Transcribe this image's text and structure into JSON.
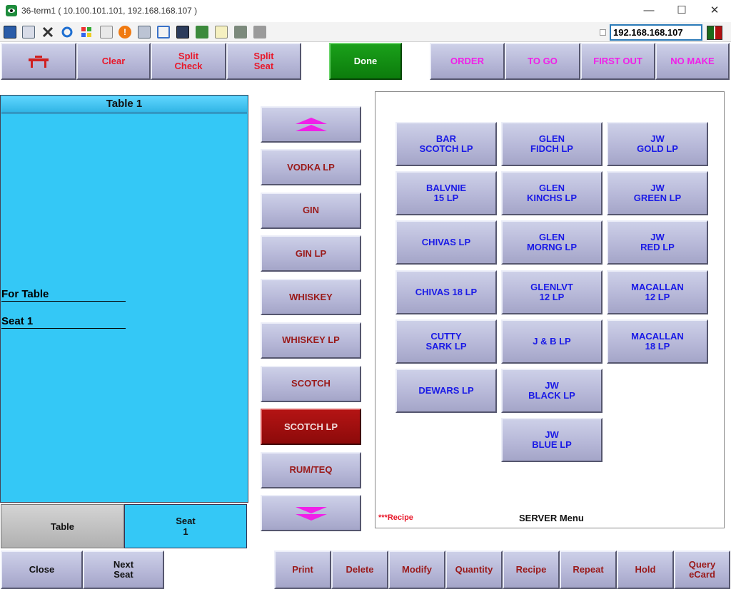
{
  "window": {
    "title": "36-term1 ( 10.100.101.101, 192.168.168.107 )",
    "minimize": "—",
    "maximize": "☐",
    "close": "✕"
  },
  "toolbar": {
    "icons": [
      "monitor-icon",
      "windows-icon",
      "tools-icon",
      "refresh-icon",
      "windows-logo-icon",
      "keyboard-icon",
      "alert-icon",
      "network-icon",
      "fullscreen-icon",
      "display-icon",
      "transfer-icon",
      "notes-icon",
      "map-icon",
      "screens-icon"
    ],
    "ip_address": "192.168.168.107"
  },
  "top_buttons": {
    "clear": "Clear",
    "split_check": "Split\nCheck",
    "split_seat": "Split\nSeat",
    "done": "Done",
    "order": "ORDER",
    "to_go": "TO GO",
    "first_out": "FIRST OUT",
    "no_make": "NO MAKE"
  },
  "check": {
    "header": "Table 1",
    "for_table": "For Table",
    "seat": "Seat 1"
  },
  "categories": [
    "VODKA LP",
    "GIN",
    "GIN LP",
    "WHISKEY",
    "WHISKEY LP",
    "SCOTCH",
    "SCOTCH LP",
    "RUM/TEQ"
  ],
  "selected_category": "SCOTCH LP",
  "items": {
    "col1": [
      "BAR\nSCOTCH LP",
      "BALVNIE\n15 LP",
      "CHIVAS LP",
      "CHIVAS 18 LP",
      "CUTTY\nSARK LP",
      "DEWARS LP"
    ],
    "col2": [
      "GLEN\nFIDCH LP",
      "GLEN\nKINCHS LP",
      "GLEN\nMORNG LP",
      "GLENLVT\n12 LP",
      "J & B LP",
      "JW\nBLACK LP",
      "JW\nBLUE LP"
    ],
    "col3": [
      "JW\nGOLD LP",
      "JW\nGREEN LP",
      "JW\nRED LP",
      "MACALLAN\n12 LP",
      "MACALLAN\n18 LP"
    ]
  },
  "menu_panel": {
    "recipe_note": "***Recipe",
    "menu_label": "SERVER Menu"
  },
  "bottom_left": {
    "table": "Table",
    "seat": "Seat\n1"
  },
  "bottom_buttons": {
    "close": "Close",
    "next_seat": "Next\nSeat",
    "print": "Print",
    "delete": "Delete",
    "modify": "Modify",
    "quantity": "Quantity",
    "recipe": "Recipe",
    "repeat": "Repeat",
    "hold": "Hold",
    "query_ecard": "Query\neCard"
  },
  "colors": {
    "check_panel": "#34c8f6",
    "button_face": "#b7b8d8",
    "done": "#0c7c0c",
    "selected": "#8c0a0a"
  }
}
